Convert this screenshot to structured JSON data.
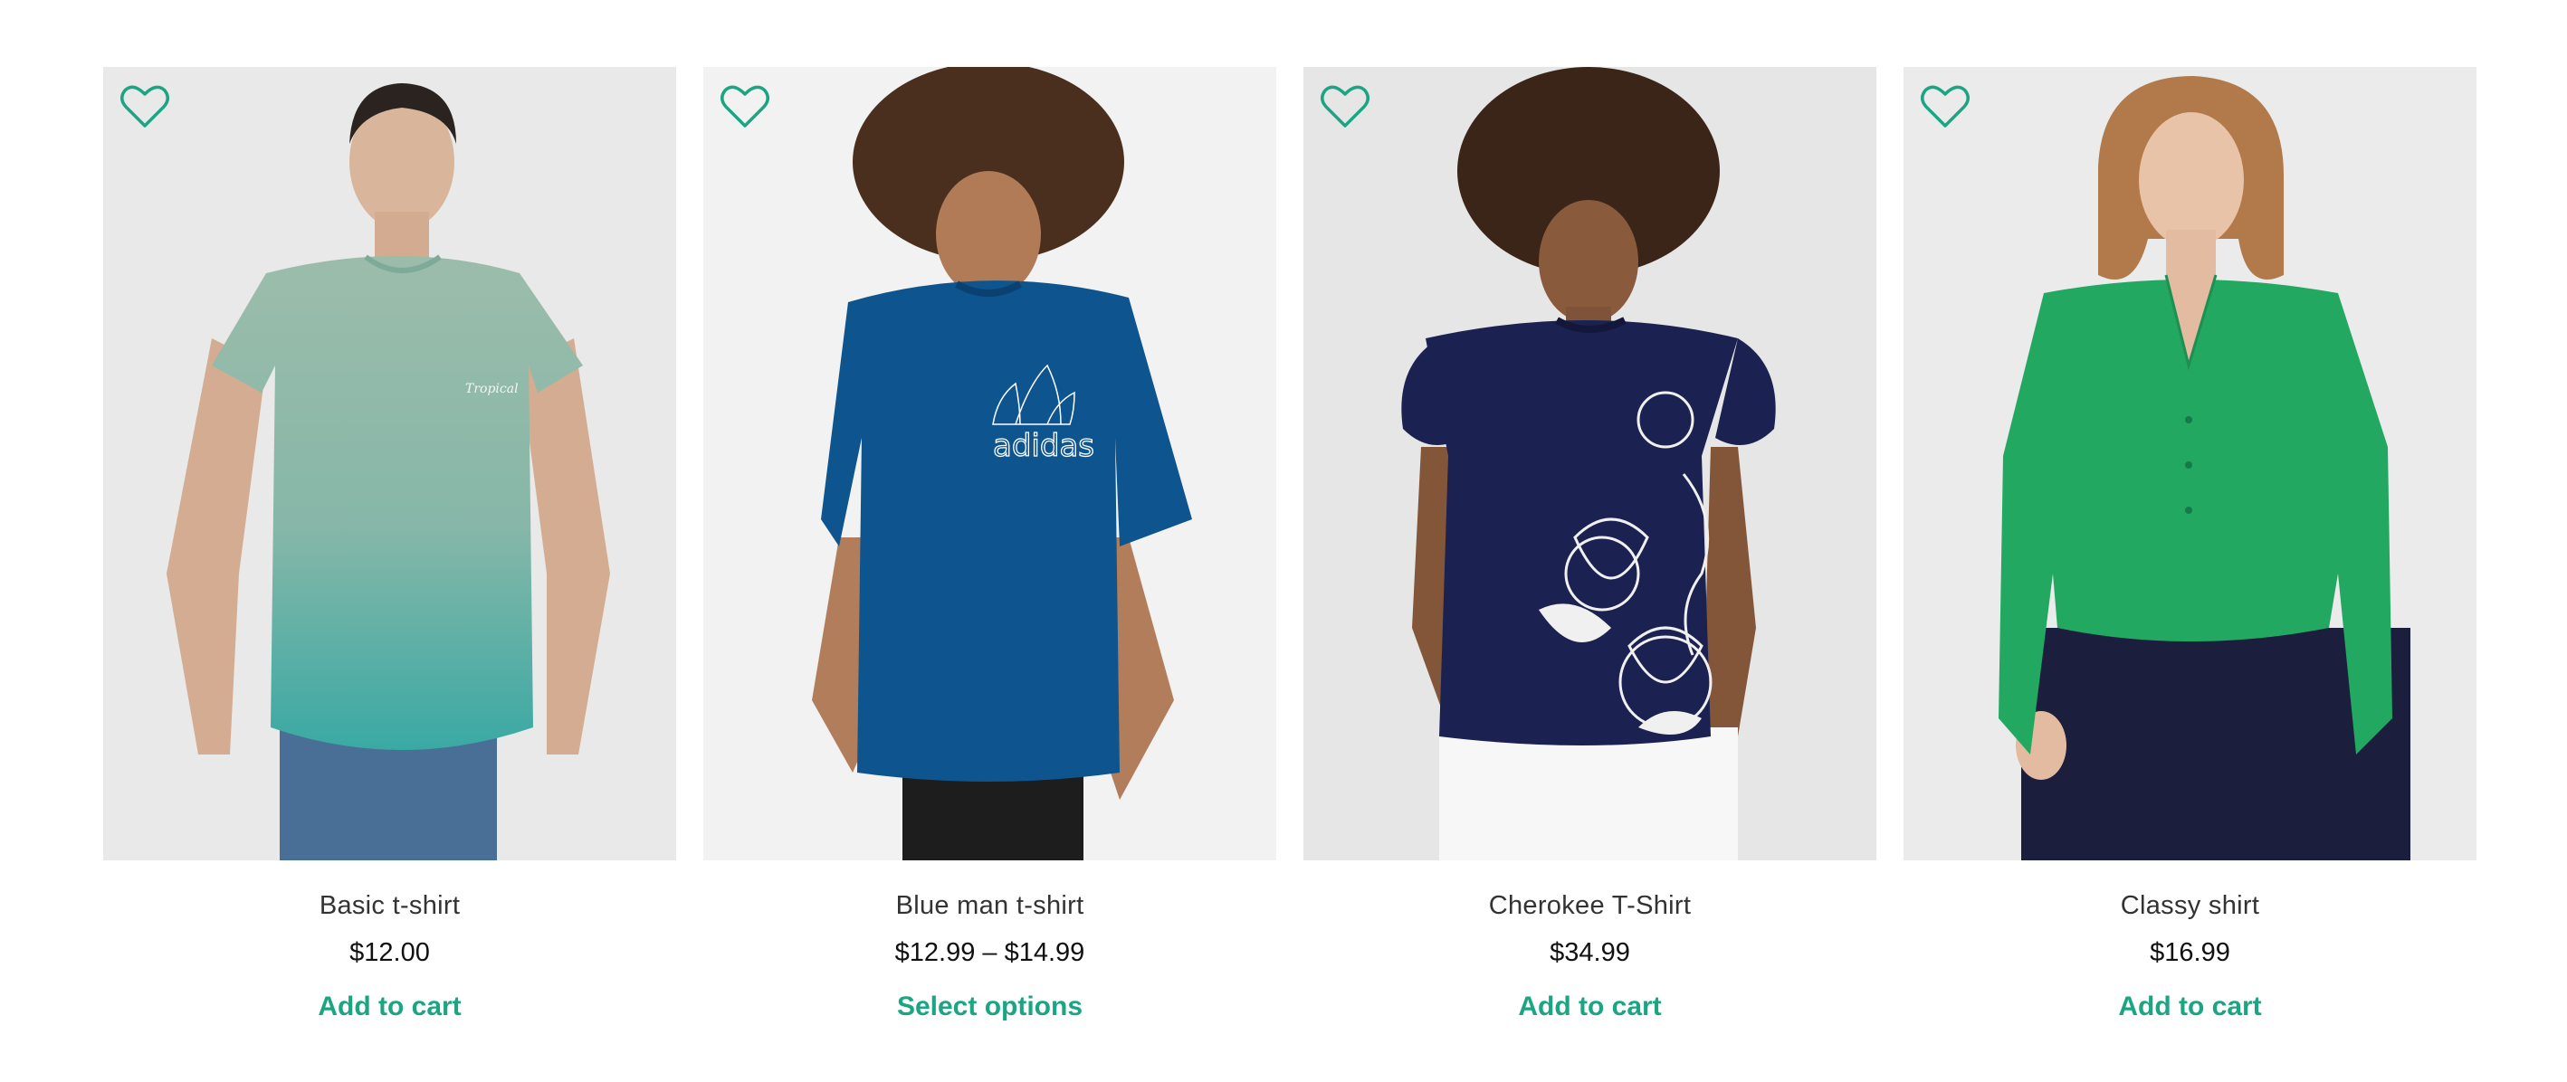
{
  "accent_color": "#1ba583",
  "products": [
    {
      "name": "Basic t-shirt",
      "price": "$12.00",
      "action": "Add to cart",
      "image": {
        "alt": "man in mint-to-teal gradient t-shirt",
        "shirt_color": "#8fbfae",
        "bg": "#e9e9ea"
      },
      "wishlist_icon": "heart-outline-icon"
    },
    {
      "name": "Blue man t-shirt",
      "price": "$12.99 – $14.99",
      "action": "Select options",
      "image": {
        "alt": "man in blue adidas t-shirt",
        "shirt_color": "#0d4f8c",
        "bg": "#f2f2f2"
      },
      "wishlist_icon": "heart-outline-icon"
    },
    {
      "name": "Cherokee T-Shirt",
      "price": "$34.99",
      "action": "Add to cart",
      "image": {
        "alt": "woman in navy floral t-shirt",
        "shirt_color": "#1b2150",
        "bg": "#e6e6e6"
      },
      "wishlist_icon": "heart-outline-icon"
    },
    {
      "name": "Classy shirt",
      "price": "$16.99",
      "action": "Add to cart",
      "image": {
        "alt": "woman in green blouse",
        "shirt_color": "#23a862",
        "bg": "#ebebeb"
      },
      "wishlist_icon": "heart-outline-icon"
    }
  ]
}
